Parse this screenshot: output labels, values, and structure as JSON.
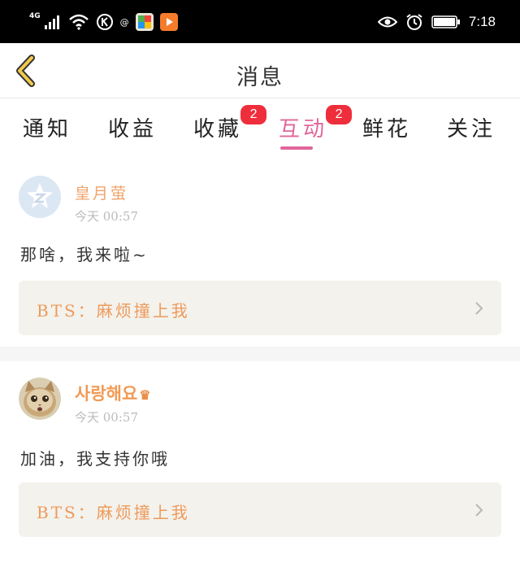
{
  "status_bar": {
    "network": "4G",
    "time": "7:18",
    "colors": {
      "background": "#000000",
      "text": "#ffffff"
    },
    "icons": [
      "signal-icon",
      "wifi-icon",
      "k-circle-icon",
      "at-icon",
      "photos-app-icon",
      "video-app-icon",
      "eye-icon",
      "alarm-icon",
      "battery-icon"
    ]
  },
  "header": {
    "title": "消息",
    "back_icon": "chevron-left-icon"
  },
  "tabs": [
    {
      "label": "通知",
      "badge": ""
    },
    {
      "label": "收益",
      "badge": ""
    },
    {
      "label": "收藏",
      "badge": "2"
    },
    {
      "label": "互动",
      "badge": "2",
      "active": true
    },
    {
      "label": "鲜花",
      "badge": ""
    },
    {
      "label": "关注",
      "badge": ""
    }
  ],
  "messages": [
    {
      "username": "皇月萤",
      "time": "今天 00:57",
      "content": "那啥，我来啦~",
      "reference": "BTS：麻烦撞上我",
      "avatar": "qq-default-avatar"
    },
    {
      "username": "사랑해요",
      "username_icon": "crown-icon",
      "time": "今天 00:57",
      "content": "加油，我支持你哦",
      "reference": "BTS：麻烦撞上我",
      "avatar": "kitten-avatar"
    }
  ],
  "colors": {
    "accent": "#e0669a",
    "badge": "#ef2e3c",
    "username": "#f0a36b",
    "reference_text": "#ee9a5c",
    "reference_bg": "#f3f2ec",
    "back_arrow": "#f2c94c"
  }
}
